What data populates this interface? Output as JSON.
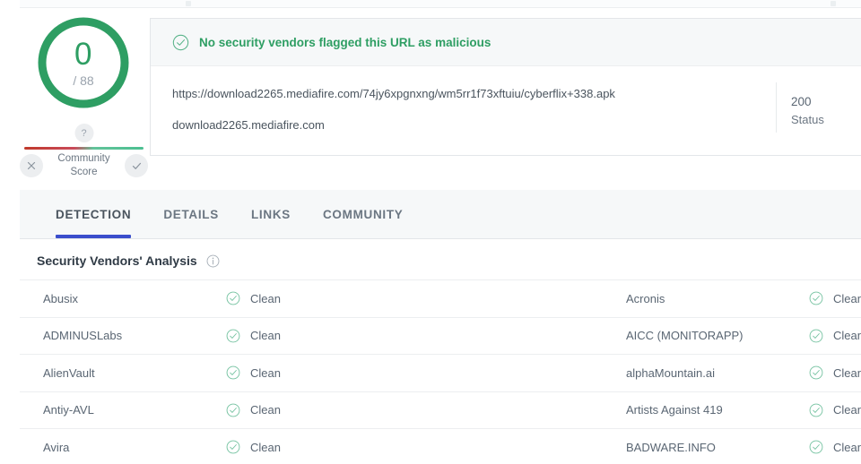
{
  "score": {
    "value": "0",
    "total": "/ 88",
    "ring_color": "#2e9e63",
    "score_color": "#2e9e63"
  },
  "community": {
    "marker": "?",
    "label_line1": "Community",
    "label_line2": "Score",
    "negative_icon": "x-icon",
    "positive_icon": "check-icon",
    "bar_negative_color": "#c0392b",
    "bar_positive_color": "#4cbf91"
  },
  "banner": {
    "icon": "check-circle-icon",
    "message": "No security vendors flagged this URL as malicious",
    "color": "#2e9e63"
  },
  "card": {
    "url": "https://download2265.mediafire.com/74jy6xpgnxng/wm5rr1f73xftuiu/cyberflix+338.apk",
    "host": "download2265.mediafire.com",
    "status_code": "200",
    "status_label": "Status"
  },
  "tabs": [
    {
      "label": "DETECTION",
      "active": true
    },
    {
      "label": "DETAILS",
      "active": false
    },
    {
      "label": "LINKS",
      "active": false
    },
    {
      "label": "COMMUNITY",
      "active": false
    }
  ],
  "analysis": {
    "title": "Security Vendors' Analysis",
    "info_icon": "info-icon"
  },
  "vendors": {
    "status_icon": "check-circle-icon",
    "rows": [
      {
        "left_name": "Abusix",
        "left_status": "Clean",
        "right_name": "Acronis",
        "right_status": "Clean"
      },
      {
        "left_name": "ADMINUSLabs",
        "left_status": "Clean",
        "right_name": "AICC (MONITORAPP)",
        "right_status": "Clean"
      },
      {
        "left_name": "AlienVault",
        "left_status": "Clean",
        "right_name": "alphaMountain.ai",
        "right_status": "Clean"
      },
      {
        "left_name": "Antiy-AVL",
        "left_status": "Clean",
        "right_name": "Artists Against 419",
        "right_status": "Clean"
      },
      {
        "left_name": "Avira",
        "left_status": "Clean",
        "right_name": "BADWARE.INFO",
        "right_status": "Clean"
      }
    ]
  }
}
